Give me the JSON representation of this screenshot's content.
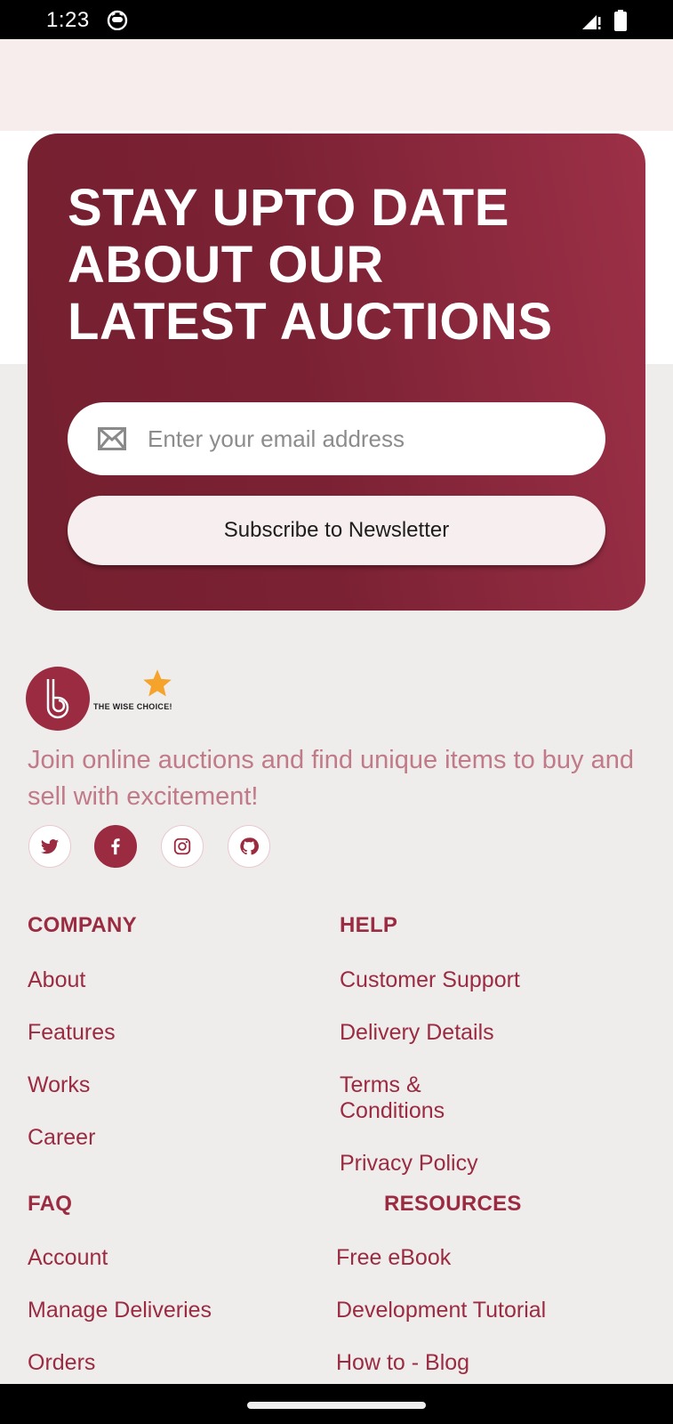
{
  "status_bar": {
    "time": "1:23"
  },
  "newsletter": {
    "title_lines": [
      "STAY UPTO DATE",
      "ABOUT OUR",
      "LATEST AUCTIONS"
    ],
    "email_placeholder": "Enter your email address",
    "subscribe_label": "Subscribe to Newsletter"
  },
  "brand": {
    "tagline": "THE WISE CHOICE!",
    "description": "Join online auctions and find unique items to buy and sell with excitement!",
    "social": [
      "twitter-icon",
      "facebook-icon",
      "instagram-icon",
      "github-icon"
    ]
  },
  "footer": {
    "company": {
      "heading": "COMPANY",
      "links": [
        "About",
        "Features",
        "Works",
        "Career"
      ]
    },
    "help": {
      "heading": "HELP",
      "links": [
        "Customer Support",
        "Delivery Details",
        "Terms & Conditions",
        "Privacy Policy"
      ]
    },
    "faq": {
      "heading": "FAQ",
      "links": [
        "Account",
        "Manage Deliveries",
        "Orders"
      ]
    },
    "resources": {
      "heading": "RESOURCES",
      "links": [
        "Free eBook",
        "Development Tutorial",
        "How to - Blog"
      ]
    }
  },
  "colors": {
    "brand": "#9a2b41",
    "card_dark": "#74202f",
    "card_light": "#9c3047",
    "star": "#f5a32b"
  }
}
